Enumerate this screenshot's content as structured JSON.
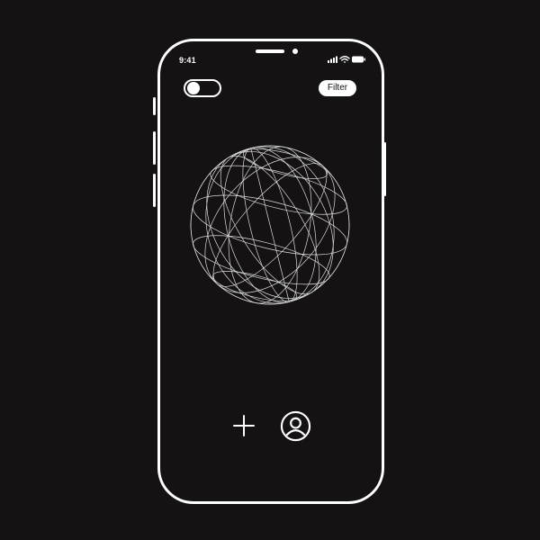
{
  "status_bar": {
    "time": "9:41",
    "icons": [
      "signal-icon",
      "wifi-icon",
      "battery-icon"
    ]
  },
  "header": {
    "toggle": {
      "state": "off"
    },
    "filter_label": "Filter"
  },
  "main": {
    "visual": "wireframe-globe-icon"
  },
  "bottom_actions": {
    "items": [
      {
        "icon": "plus-icon"
      },
      {
        "icon": "user-profile-icon"
      }
    ]
  },
  "colors": {
    "background": "#141213",
    "foreground": "#ffffff"
  }
}
